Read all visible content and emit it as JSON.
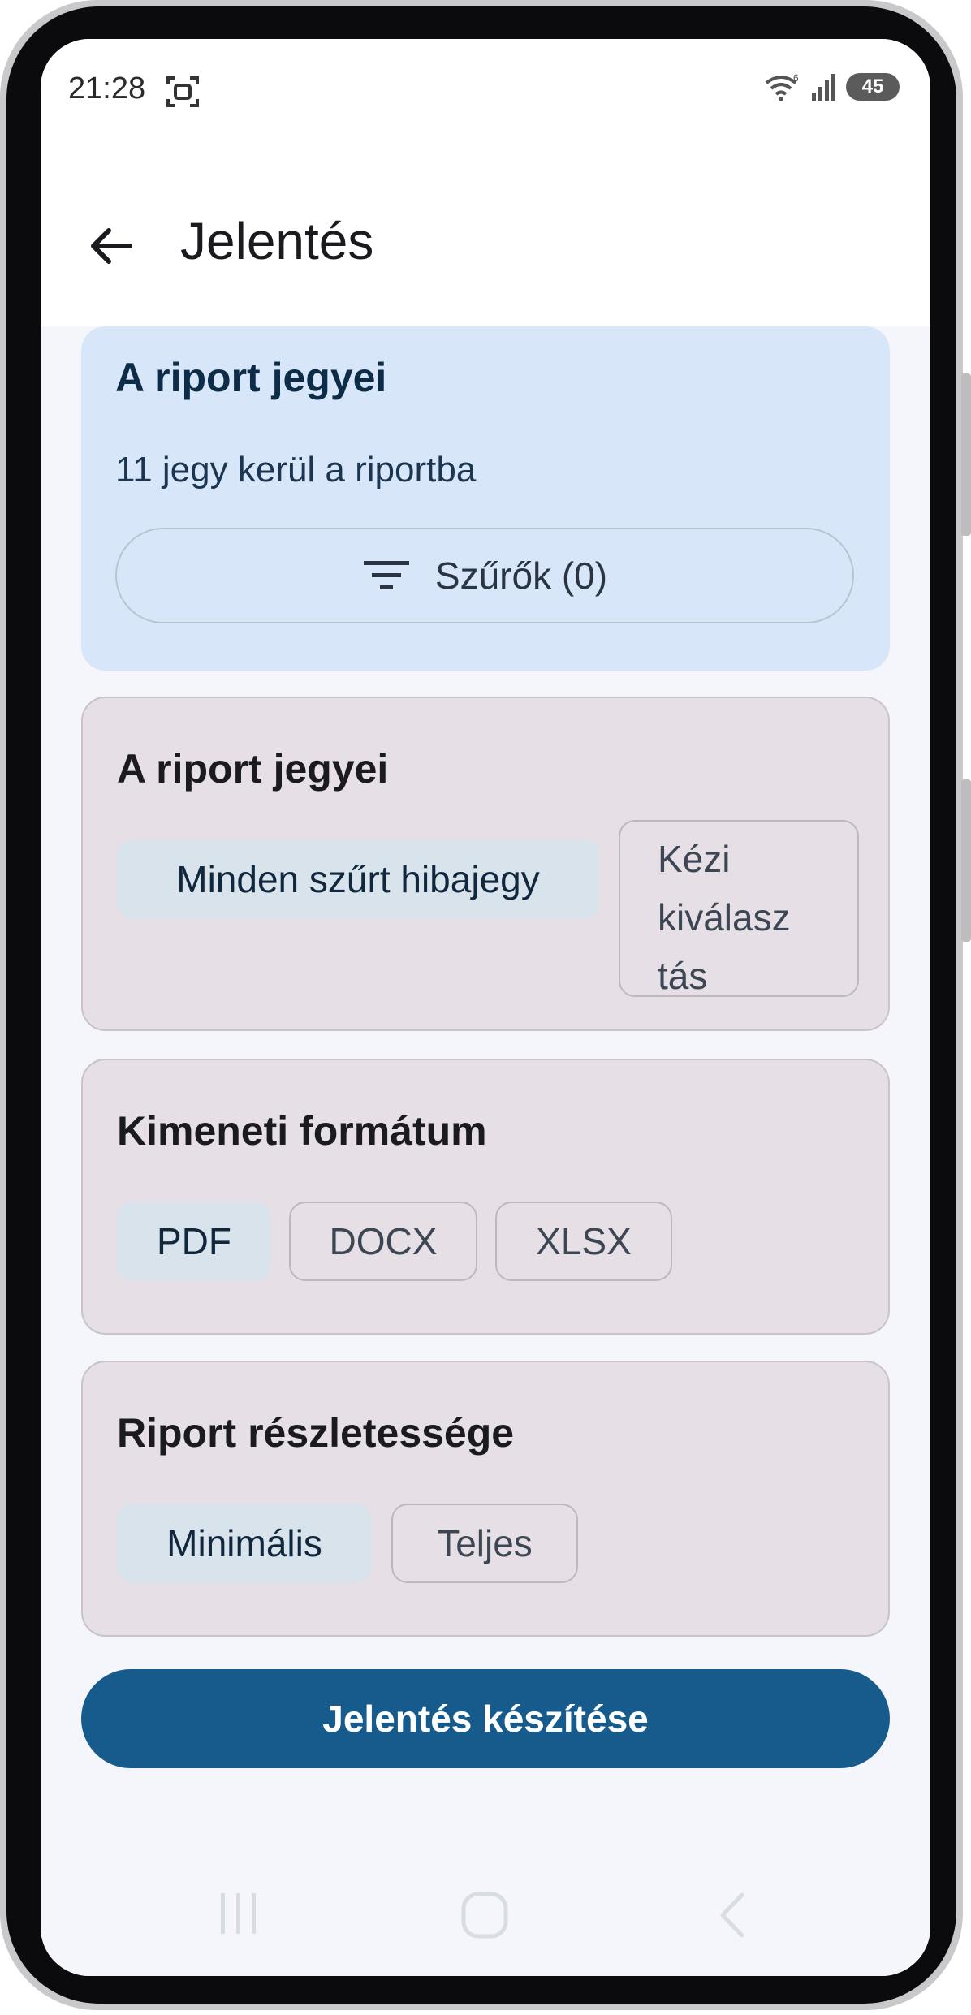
{
  "status_bar": {
    "time": "21:28",
    "battery": "45",
    "icons": [
      "screenshot-icon",
      "wifi-icon",
      "signal-icon",
      "battery-icon"
    ]
  },
  "app_bar": {
    "title": "Jelentés",
    "back_icon": "arrow-back-icon"
  },
  "tickets_summary": {
    "title": "A riport jegyei",
    "subtitle": "11 jegy kerül a riportba",
    "filter_button_label": "Szűrők (0)",
    "filter_icon": "filter-icon"
  },
  "ticket_selection": {
    "title": "A riport jegyei",
    "options": [
      {
        "label": "Minden szűrt hibajegy",
        "selected": true
      },
      {
        "label": "Kézi kiválasztás",
        "selected": false,
        "lines": [
          "Kézi",
          "kiválasz",
          "tás"
        ]
      }
    ]
  },
  "output_format": {
    "title": "Kimeneti formátum",
    "options": [
      {
        "label": "PDF",
        "selected": true
      },
      {
        "label": "DOCX",
        "selected": false
      },
      {
        "label": "XLSX",
        "selected": false
      }
    ]
  },
  "report_detail": {
    "title": "Riport részletessége",
    "options": [
      {
        "label": "Minimális",
        "selected": true
      },
      {
        "label": "Teljes",
        "selected": false
      }
    ]
  },
  "primary_action": {
    "label": "Jelentés készítése"
  },
  "colors": {
    "primary": "#175a8c",
    "summary_card": "#d7e7f9",
    "option_card": "#e6dfe6",
    "selected_chip": "#d8e3ec"
  }
}
